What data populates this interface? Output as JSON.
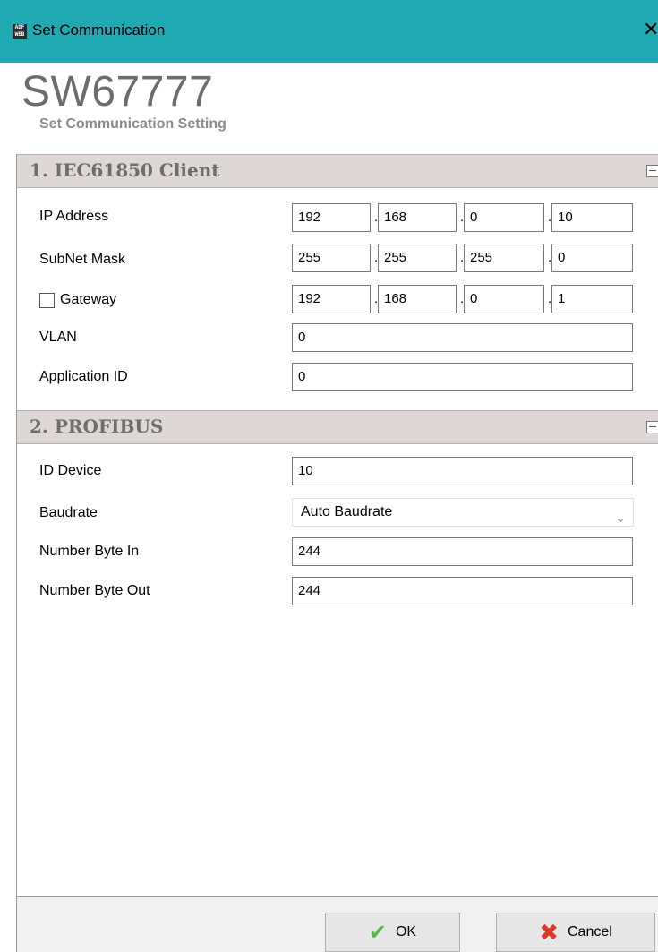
{
  "window": {
    "title": "Set Communication",
    "app_icon_text": "ADF WEB",
    "close_glyph": "✕"
  },
  "header": {
    "product": "SW67777",
    "subtitle": "Set Communication Setting"
  },
  "section1": {
    "title": "1. IEC61850 Client",
    "ip_label": "IP Address",
    "ip": [
      "192",
      "168",
      "0",
      "10"
    ],
    "subnet_label": "SubNet Mask",
    "subnet": [
      "255",
      "255",
      "255",
      "0"
    ],
    "gateway_label": "Gateway",
    "gateway_checked": false,
    "gateway": [
      "192",
      "168",
      "0",
      "1"
    ],
    "vlan_label": "VLAN",
    "vlan": "0",
    "appid_label": "Application ID",
    "appid": "0"
  },
  "section2": {
    "title": "2. PROFIBUS",
    "id_label": "ID Device",
    "id": "10",
    "baud_label": "Baudrate",
    "baud": "Auto Baudrate",
    "in_label": "Number Byte In",
    "in": "244",
    "out_label": "Number Byte Out",
    "out": "244"
  },
  "footer": {
    "ok_label": "OK",
    "cancel_label": "Cancel",
    "ok_icon": "checkmark-icon",
    "cancel_icon": "cross-icon"
  }
}
